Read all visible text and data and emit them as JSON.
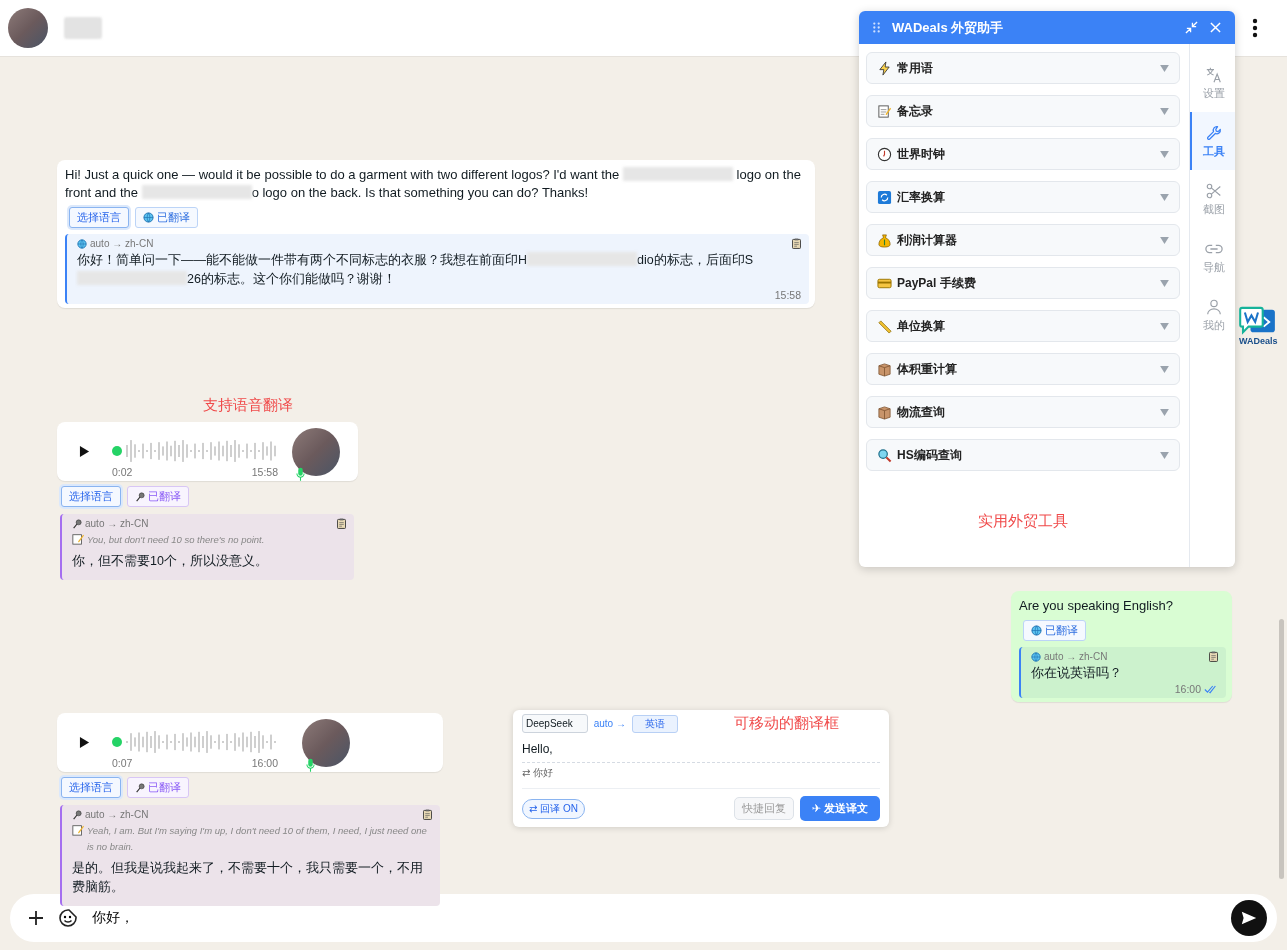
{
  "chat_input": {
    "value": "你好，"
  },
  "messages": [
    {
      "kind": "text",
      "outgoing": false,
      "parts": [
        {
          "kind": "text",
          "text": "Hi! Just a quick one — would it be possible to do a garment with two different logos? I'd want the "
        },
        {
          "kind": "redacted"
        },
        {
          "kind": "text",
          "text": " logo on the front and the "
        },
        {
          "kind": "redacted"
        },
        {
          "kind": "text",
          "text": "o logo on the back. Is that something you can do? Thanks!"
        }
      ],
      "buttons": [
        {
          "label": "选择语言",
          "kind": "language"
        },
        {
          "label": "已翻译",
          "kind": "translated"
        }
      ],
      "translation": {
        "route": "auto → zh-CN",
        "parts": [
          {
            "kind": "text",
            "text": "你好！简单问一下——能不能做一件带有两个不同标志的衣服？我想在前面印H"
          },
          {
            "kind": "redacted"
          },
          {
            "kind": "text",
            "text": "dio的标志，后面印S"
          },
          {
            "kind": "redacted"
          },
          {
            "kind": "text",
            "text": "26的标志。这个你们能做吗？谢谢！"
          }
        ]
      },
      "time": "15:58"
    },
    {
      "kind": "voice",
      "outgoing": false,
      "caption": "支持语音翻译",
      "duration": "0:02",
      "time": "15:58",
      "buttons": [
        {
          "label": "选择语言",
          "kind": "language"
        },
        {
          "label": "已翻译",
          "kind": "translated"
        }
      ],
      "translation": {
        "route": "auto → zh-CN",
        "transcript": "You, but don't need 10 so there's no point.",
        "parts": [
          {
            "kind": "text",
            "text": "你，但不需要10个，所以没意义。"
          }
        ]
      }
    },
    {
      "kind": "text",
      "outgoing": true,
      "parts": [
        {
          "kind": "text",
          "text": "Are you speaking English?"
        }
      ],
      "buttons": [
        {
          "label": "已翻译",
          "kind": "translated"
        }
      ],
      "translation": {
        "route": "auto → zh-CN",
        "parts": [
          {
            "kind": "text",
            "text": "你在说英语吗？"
          }
        ]
      },
      "time": "16:00",
      "read": true
    },
    {
      "kind": "voice",
      "outgoing": false,
      "duration": "0:07",
      "time": "16:00",
      "buttons": [
        {
          "label": "选择语言",
          "kind": "language"
        },
        {
          "label": "已翻译",
          "kind": "translated"
        }
      ],
      "translation": {
        "route": "auto → zh-CN",
        "transcript": "Yeah, I am. But I'm saying I'm up, I don't need 10 of them, I need, I just need one is no brain.",
        "parts": [
          {
            "kind": "text",
            "text": "是的。但我是说我起来了，不需要十个，我只需要一个，不用费脑筋。"
          }
        ]
      }
    }
  ],
  "assistant_panel": {
    "title": "WADeals 外贸助手",
    "tools": [
      {
        "label": "常用语"
      },
      {
        "label": "备忘录"
      },
      {
        "label": "世界时钟"
      },
      {
        "label": "汇率换算"
      },
      {
        "label": "利润计算器"
      },
      {
        "label": "PayPal 手续费"
      },
      {
        "label": "单位换算"
      },
      {
        "label": "体积重计算"
      },
      {
        "label": "物流查询"
      },
      {
        "label": "HS编码查询"
      }
    ],
    "caption": "实用外贸工具",
    "tabs": [
      {
        "label": "设置",
        "selected": false
      },
      {
        "label": "工具",
        "selected": true
      },
      {
        "label": "截图",
        "selected": false
      },
      {
        "label": "导航",
        "selected": false
      },
      {
        "label": "我的",
        "selected": false
      }
    ]
  },
  "floating_logo": {
    "label": "WADeals"
  },
  "translator": {
    "engine": "DeepSeek",
    "source": "auto →",
    "target": "英语",
    "caption": "可移动的翻译框",
    "input": "Hello,",
    "back_translation": "⇄ 你好",
    "toggle": {
      "label": "⇄ 回译 ON",
      "on": true
    },
    "buttons": [
      {
        "label": "快捷回复",
        "kind": "secondary"
      },
      {
        "label": "✈ 发送译文",
        "kind": "primary"
      }
    ]
  }
}
